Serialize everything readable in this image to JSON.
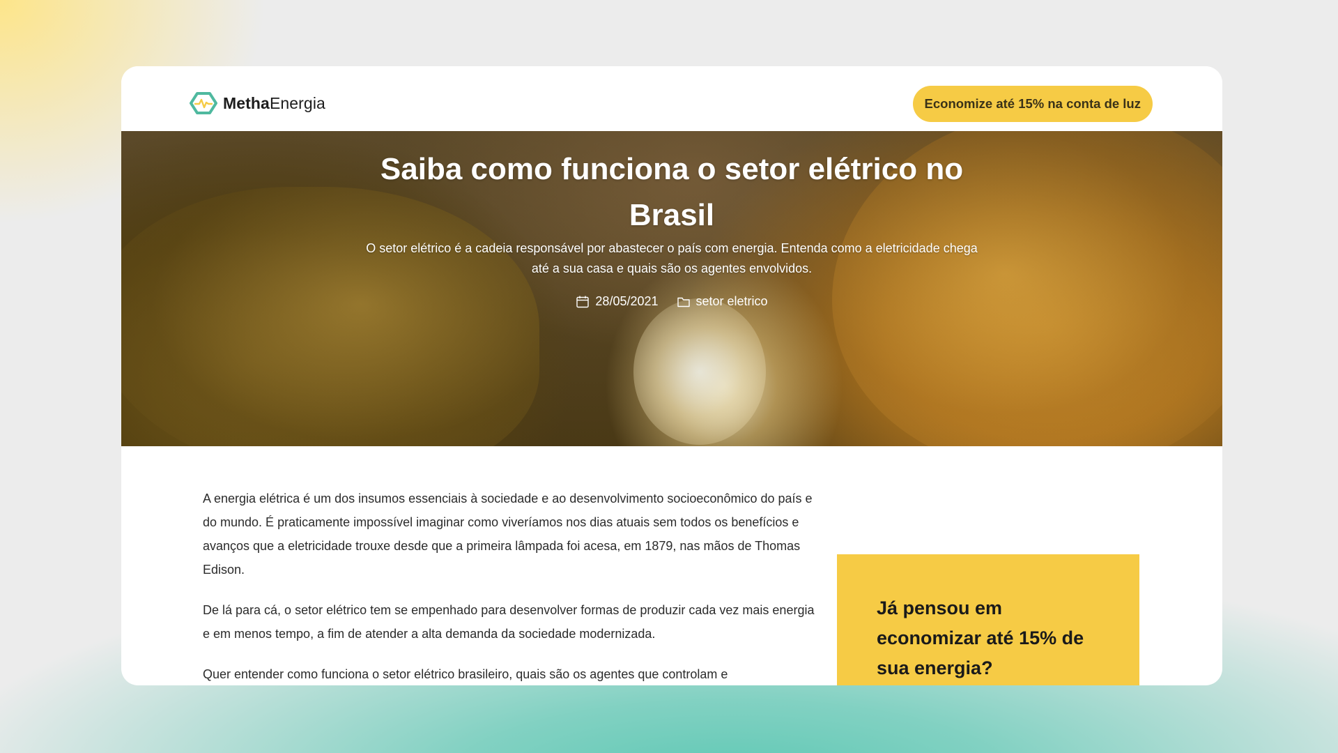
{
  "header": {
    "logo_bold": "Metha",
    "logo_regular": "Energia",
    "cta_label": "Economize até 15% na conta de luz"
  },
  "hero": {
    "title": "Saiba como funciona o setor elétrico no Brasil",
    "subtitle": "O setor elétrico é a cadeia responsável por abastecer o país com energia. Entenda como a eletricidade chega até a sua casa e quais são os agentes envolvidos.",
    "date": "28/05/2021",
    "category": "setor eletrico"
  },
  "article": {
    "paragraphs": [
      "A energia elétrica é um dos insumos essenciais à sociedade e ao desenvolvimento socioeconômico do país e do mundo. É praticamente impossível imaginar como viveríamos  nos dias atuais sem todos os benefícios e avanços que a eletricidade trouxe desde que a primeira lâmpada foi acesa, em 1879, nas mãos de Thomas Edison.",
      "De lá para cá, o setor elétrico tem se empenhado para desenvolver formas de produzir cada vez mais energia e em menos tempo, a fim de atender a alta demanda da sociedade modernizada.",
      "Quer entender como funciona o setor elétrico brasileiro, quais são os agentes que controlam e"
    ]
  },
  "promo": {
    "title": "Já pensou em economizar até 15% de sua energia?"
  },
  "colors": {
    "accent_yellow": "#f6cb45",
    "logo_green": "#4fb99f",
    "text_dark": "#2b2b2b"
  },
  "icons": {
    "logo": "hexagon-pulse-icon",
    "date": "calendar-icon",
    "category": "folder-icon"
  }
}
